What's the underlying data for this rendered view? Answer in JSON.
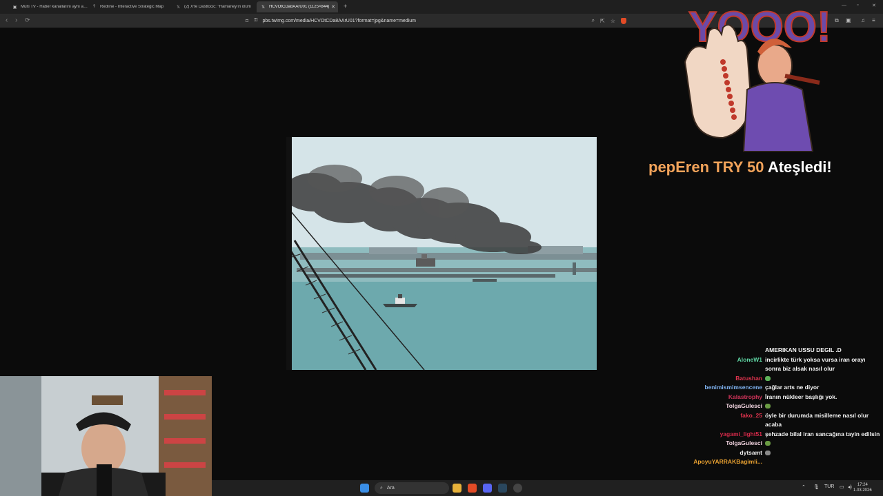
{
  "browser": {
    "tabs": [
      {
        "label": "Multi TV - Haber kanallarını aynı anda",
        "icon": "tv-icon"
      },
      {
        "label": "Redline - Interactive Strategic Map",
        "icon": "redline-icon"
      },
      {
        "label": "(2) X'te Dastlocic: \"Hamaney'in ölüm",
        "icon": "x-logo-icon"
      },
      {
        "label": "HCVOtCDa8AArU01 (1125×844)",
        "icon": "x-logo-icon",
        "active": true
      }
    ],
    "url": "pbs.twimg.com/media/HCVOtCDa8AArU01?format=jpg&name=medium"
  },
  "alert": {
    "name": "pepEren",
    "amount": "TRY 50",
    "action": "Ateşledi!",
    "overlay_text": "YOOO!"
  },
  "chat": {
    "messages": [
      {
        "user": "",
        "text": "AMERIKAN USSU DEGIL .D",
        "color": "#ffffff"
      },
      {
        "user": "AloneW1",
        "text": "incirlikte türk yoksa vursa iran orayı sonra biz alsak nasıl olur",
        "color": "#5fd6a4"
      },
      {
        "user": "Batushan",
        "text": "",
        "color": "#e0344e",
        "emote": "#5fb35a"
      },
      {
        "user": "benimismimsencene",
        "text": "çağlar arts ne diyor",
        "color": "#7fb2f0"
      },
      {
        "user": "Kalastrophy",
        "text": "İranın nükleer başlığı yok.",
        "color": "#d0345a"
      },
      {
        "user": "TolgaGulesci",
        "text": "",
        "color": "#f2d4e0",
        "emote": "#6a9b43"
      },
      {
        "user": "fako_25",
        "text": "öyle bir durumda misilleme nasıl olur acaba",
        "color": "#e0344e"
      },
      {
        "user": "yagami_light51",
        "text": "şehzade bilal iran sancağına tayin edilsin",
        "color": "#d62a4a"
      },
      {
        "user": "TolgaGulesci",
        "text": "",
        "color": "#f2d4e0",
        "emote": "#6a9b43"
      },
      {
        "user": "dytsamt",
        "text": "",
        "color": "#e8e8e8",
        "emote": "#8a8a8a"
      },
      {
        "user": "ApoyuYARRAKBagimli...",
        "text": "",
        "color": "#e8a030"
      }
    ]
  },
  "taskbar": {
    "search_label": "Ara",
    "language": "TUR",
    "time": "17:24",
    "date": "1.03.2026"
  }
}
